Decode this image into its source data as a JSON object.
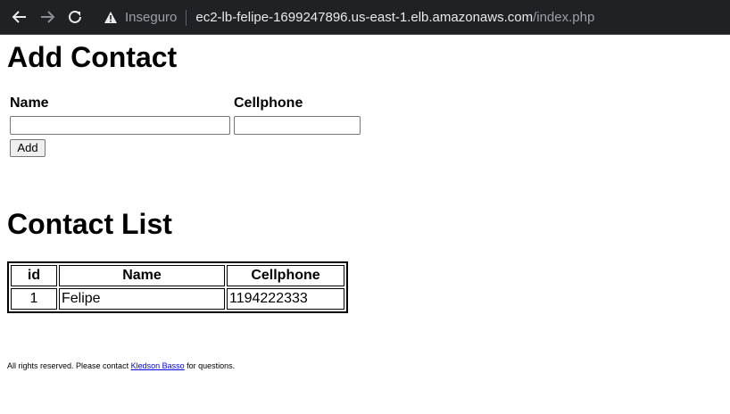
{
  "browser": {
    "insecure_label": "Inseguro",
    "url_host": "ec2-lb-felipe-1699247896.us-east-1.elb.amazonaws.com",
    "url_path": "/index.php",
    "colors": {
      "bar_bg": "#202124",
      "text": "#e8eaed",
      "muted": "#9aa0a6"
    }
  },
  "add_form": {
    "title": "Add Contact",
    "name_label": "Name",
    "cellphone_label": "Cellphone",
    "name_value": "",
    "cellphone_value": "",
    "add_button_label": "Add"
  },
  "contact_list": {
    "title": "Contact List",
    "columns": [
      "id",
      "Name",
      "Cellphone"
    ],
    "rows": [
      {
        "id": "1",
        "name": "Felipe",
        "cellphone": "1194222333"
      }
    ]
  },
  "footer": {
    "prefix": "All rights reserved. Please contact ",
    "link_text": "Kledson Basso",
    "suffix": " for questions."
  }
}
